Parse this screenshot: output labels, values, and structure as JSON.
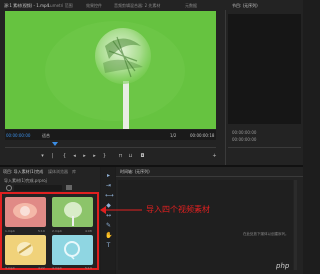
{
  "source_tabs": [
    "源:1 素材(视频) - 1.mp4",
    "Lumetri 范围",
    "效果控件",
    "音频剪辑混合器: 2 先素材",
    "元数据"
  ],
  "program_tab": "节目: (无序列)",
  "program_timecode_left": "00:00:00:00",
  "program_timecode_right": "00:00:00:00",
  "source_timecode_left": "00:00:00:00",
  "source_fit_label": "适合",
  "source_ratio_label": "1/2",
  "source_timecode_right": "00:00:00:18",
  "project_tabs": [
    "项目: 导入素材(1)完成",
    "媒体浏览器",
    "库"
  ],
  "project_name": "导入素材(1)完成.prproj",
  "timeline_tab": "时间轴: (无序列)",
  "timeline_empty_hint": "在此处放下媒体以创建序列。",
  "annotation_text": "导入四个视频素材",
  "media_items": [
    {
      "name": "1.mp4",
      "duration": "5:19",
      "color": "#e08a86"
    },
    {
      "name": "2.mp4",
      "duration": "4:08",
      "color": "#8cc46a"
    },
    {
      "name": "3.mp4",
      "duration": "4:22",
      "color": "#f0d27a"
    },
    {
      "name": "4.mp4",
      "duration": "5:13",
      "color": "#8fd6e2"
    }
  ],
  "watermark": "php",
  "colors": {
    "accent_blue": "#3b8ee6",
    "highlight_red": "#e02020",
    "video_green": "#66c340"
  }
}
